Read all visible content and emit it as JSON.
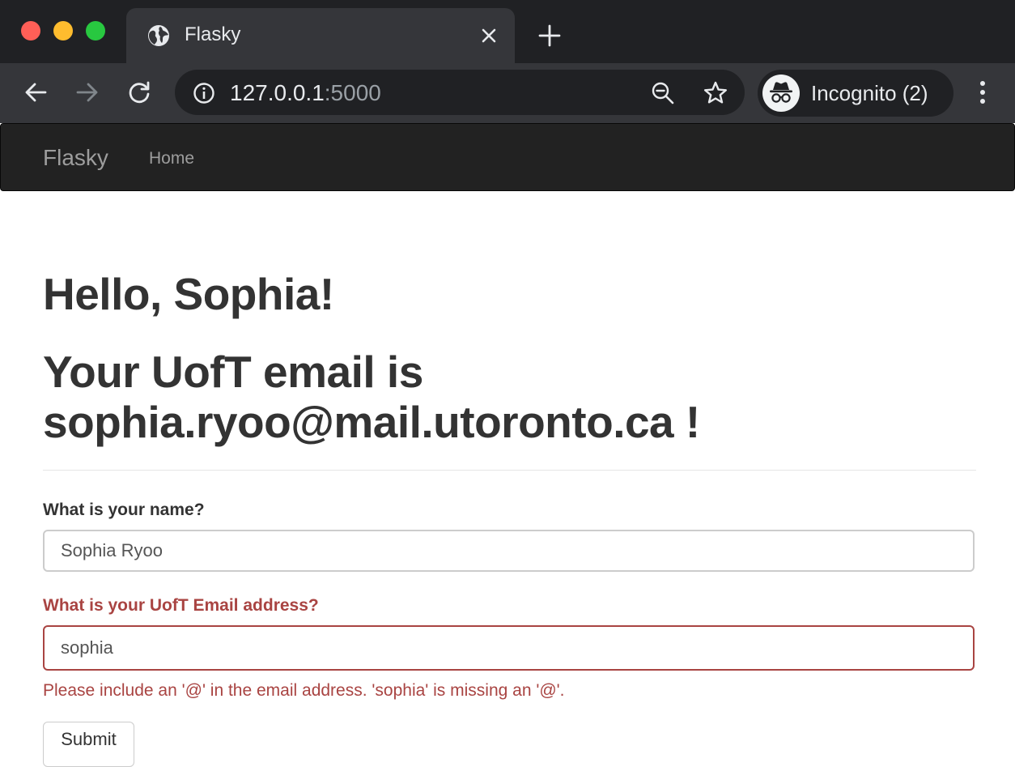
{
  "browser": {
    "tab": {
      "title": "Flasky",
      "favicon": "globe-icon"
    },
    "address": {
      "host": "127.0.0.1",
      "port": ":5000"
    },
    "profile": {
      "label": "Incognito (2)",
      "icon": "incognito-icon"
    },
    "window_controls": {
      "close_color": "#ff5f57",
      "minimize_color": "#febc2e",
      "zoom_color": "#28c840"
    }
  },
  "navbar": {
    "brand": "Flasky",
    "links": [
      {
        "label": "Home"
      }
    ]
  },
  "main": {
    "greeting": "Hello, Sophia!",
    "email_message": "Your UofT email is sophia.ryoo@mail.utoronto.ca !",
    "form": {
      "name_label": "What is your name?",
      "name_value": "Sophia Ryoo",
      "email_label": "What is your UofT Email address?",
      "email_value": "sophia",
      "email_error": "Please include an '@' in the email address. 'sophia' is missing an '@'.",
      "submit_label": "Submit"
    }
  },
  "colors": {
    "navbar_bg": "#222222",
    "error": "#a94442",
    "heading": "#333333"
  }
}
